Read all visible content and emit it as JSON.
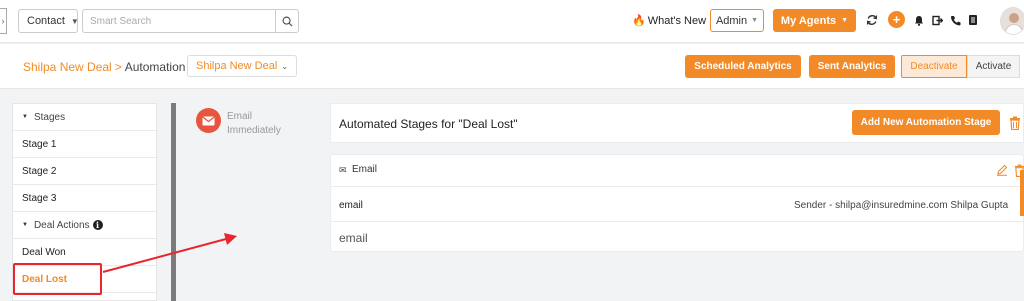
{
  "topbar": {
    "contact_select": "Contact",
    "search_placeholder": "Smart Search",
    "whats_new": "What's New",
    "admin_select": "Admin",
    "my_agents": "My Agents"
  },
  "subheader": {
    "breadcrumb_deal": "Shilpa New Deal",
    "breadcrumb_sep": ">",
    "breadcrumb_page": "Automation",
    "deal_select": "Shilpa New Deal",
    "scheduled_analytics": "Scheduled Analytics",
    "sent_analytics": "Sent Analytics",
    "deactivate": "Deactivate",
    "activate": "Activate"
  },
  "sidebar": {
    "stages_group": "Stages",
    "stage1": "Stage 1",
    "stage2": "Stage 2",
    "stage3": "Stage 3",
    "deal_actions_group": "Deal Actions",
    "deal_won": "Deal Won",
    "deal_lost": "Deal Lost"
  },
  "trigger": {
    "label": "Email Immediately"
  },
  "main": {
    "title": "Automated Stages for \"Deal Lost\"",
    "add_stage": "Add New Automation Stage",
    "card_title": "Email",
    "row_key": "email",
    "row_value": "Sender - shilpa@insuredmine.com Shilpa Gupta",
    "row2_text": "email"
  },
  "colors": {
    "accent": "#f28b27",
    "annotation": "#e8262b",
    "email_badge": "#e8553f"
  }
}
